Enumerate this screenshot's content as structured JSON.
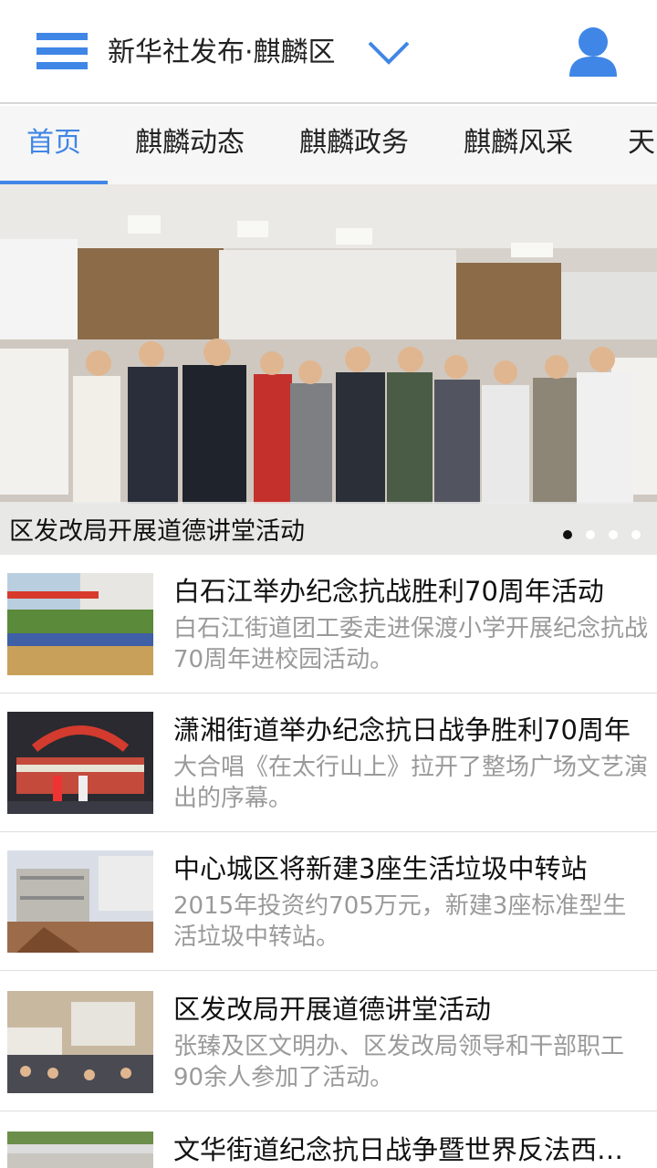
{
  "header": {
    "title": "新华社发布·麒麟区",
    "menu_icon": "hamburger-menu-icon",
    "dropdown_icon": "chevron-down-icon",
    "user_icon": "user-profile-icon",
    "accent_color": "#3f86e6"
  },
  "tabs": [
    {
      "label": "首页",
      "active": true
    },
    {
      "label": "麒麟动态",
      "active": false
    },
    {
      "label": "麒麟政务",
      "active": false
    },
    {
      "label": "麒麟风采",
      "active": false
    },
    {
      "label": "天",
      "active": false
    }
  ],
  "banner": {
    "caption": "区发改局开展道德讲堂活动",
    "slide_count": 4,
    "active_slide": 1
  },
  "news": [
    {
      "title": "白石江举办纪念抗战胜利70周年活动",
      "desc": "白石江街道团工委走进保渡小学开展纪念抗战70周年进校园活动。"
    },
    {
      "title": "潇湘街道举办纪念抗日战争胜利70周年",
      "desc": "大合唱《在太行山上》拉开了整场广场文艺演出的序幕。"
    },
    {
      "title": "中心城区将新建3座生活垃圾中转站",
      "desc": "2015年投资约705万元，新建3座标准型生活垃圾中转站。"
    },
    {
      "title": "区发改局开展道德讲堂活动",
      "desc": "张臻及区文明办、区发改局领导和干部职工90余人参加了活动。"
    },
    {
      "title": "文华街道纪念抗日战争暨世界反法西斯战争胜利",
      "desc": ""
    }
  ]
}
